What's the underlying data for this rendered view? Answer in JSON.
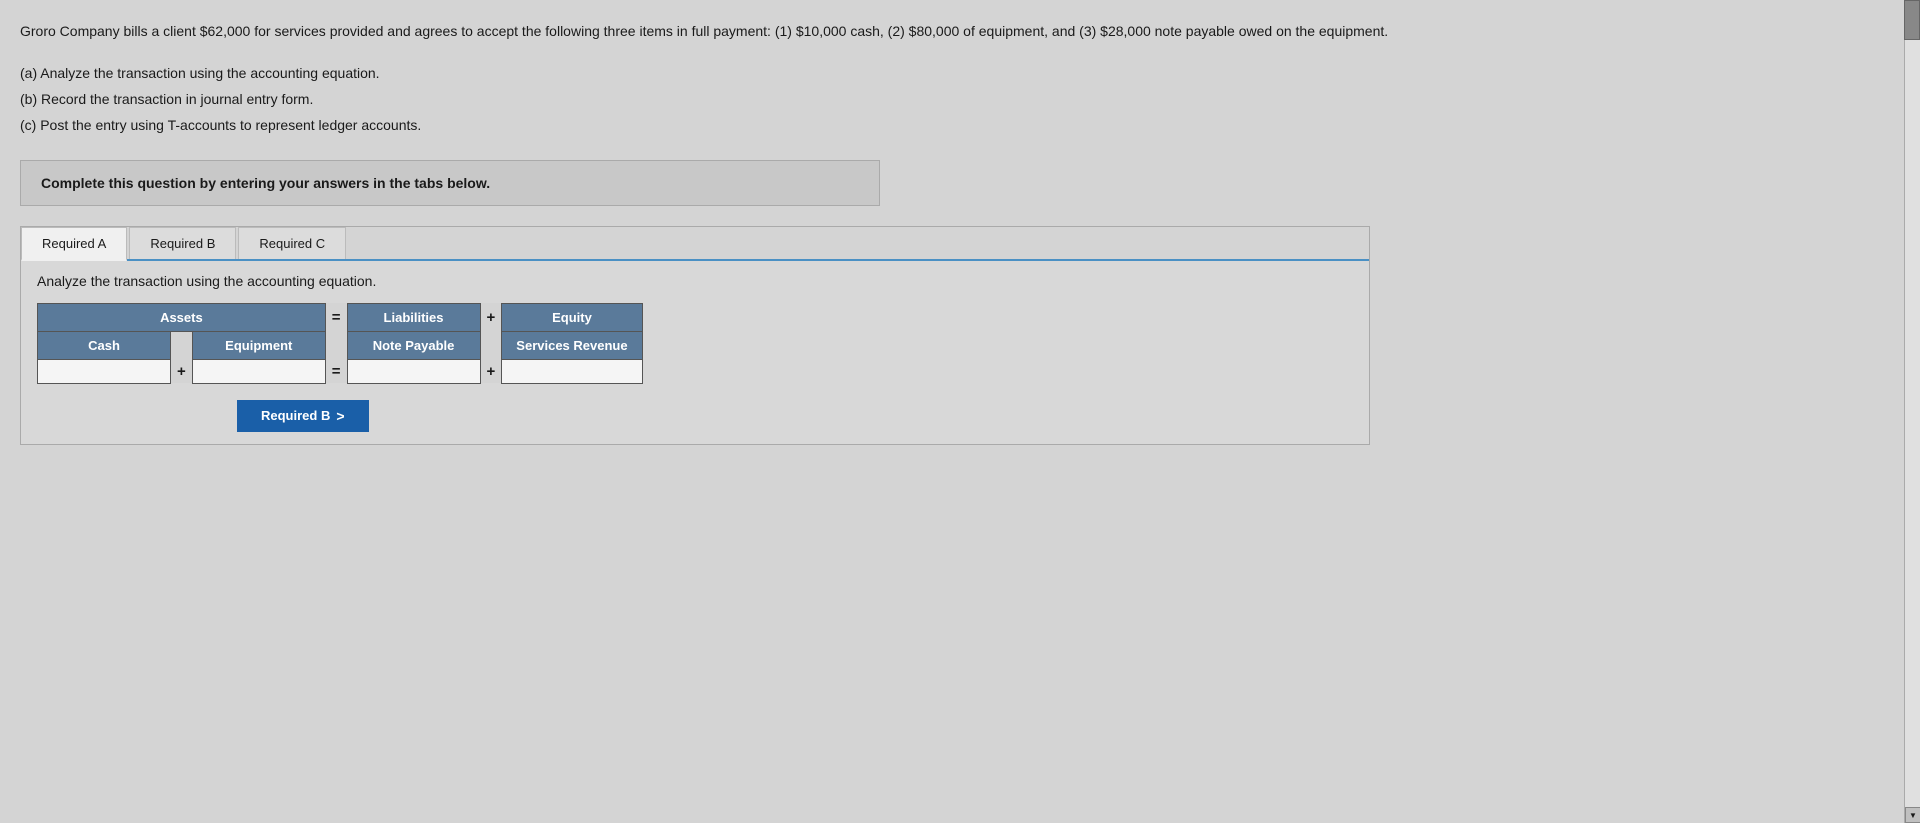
{
  "intro": {
    "text": "Groro Company bills a client $62,000 for services provided and agrees to accept the following three items in full payment: (1) $10,000 cash, (2) $80,000 of equipment, and (3) $28,000 note payable owed on the equipment."
  },
  "parts": {
    "a": "(a) Analyze the transaction using the accounting equation.",
    "b": "(b) Record the transaction in journal entry form.",
    "c": "(c) Post the entry using T-accounts to represent ledger accounts."
  },
  "complete_box": {
    "text": "Complete this question by entering your answers in the tabs below."
  },
  "tabs": {
    "items": [
      {
        "label": "Required A",
        "active": true
      },
      {
        "label": "Required B",
        "active": false
      },
      {
        "label": "Required C",
        "active": false
      }
    ]
  },
  "tab_content": {
    "analyze_text": "Analyze the transaction using the accounting equation.",
    "table": {
      "header_row": [
        {
          "label": "Assets",
          "colspan": 3
        },
        {
          "label": "=",
          "operator": true
        },
        {
          "label": "Liabilities",
          "colspan": 1
        },
        {
          "label": "+",
          "operator": true
        },
        {
          "label": "Equity",
          "colspan": 1
        }
      ],
      "sub_header_row": [
        {
          "label": "Cash"
        },
        {
          "label": ""
        },
        {
          "label": "Equipment"
        },
        {
          "label": "Note Payable"
        },
        {
          "label": "Services Revenue"
        }
      ],
      "input_row": {
        "cash_placeholder": "",
        "equipment_placeholder": "",
        "note_payable_placeholder": "",
        "services_revenue_placeholder": ""
      }
    },
    "next_button": {
      "label": "Required B",
      "arrow": ">"
    }
  },
  "scrollbar": {
    "up_arrow": "▲",
    "down_arrow": "▼"
  }
}
